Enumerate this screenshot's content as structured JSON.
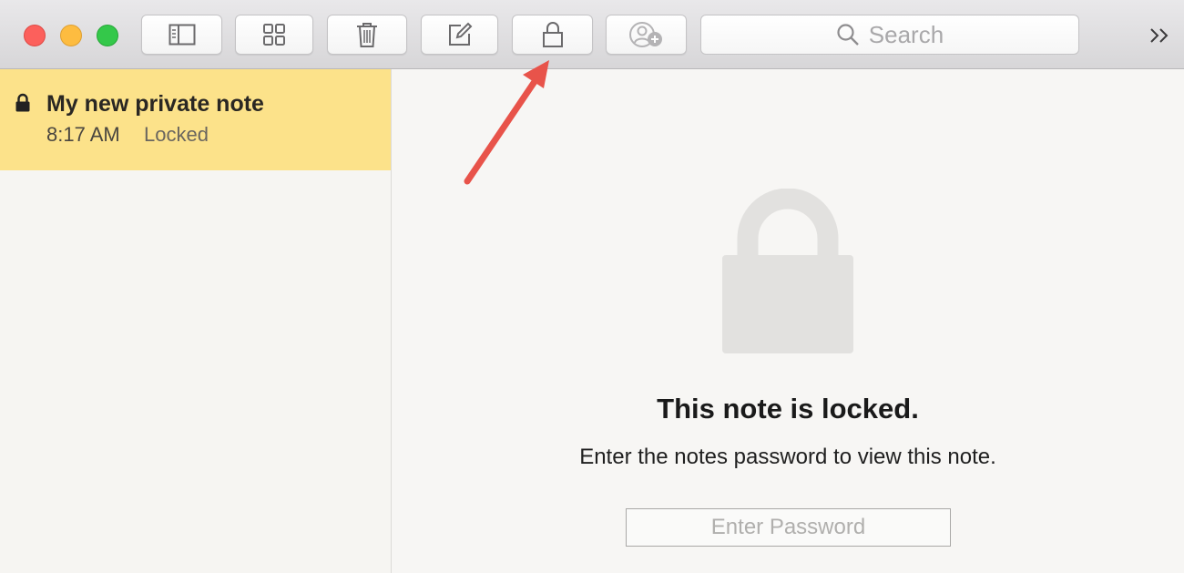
{
  "toolbar": {
    "buttons": [
      {
        "name": "toggle-sidebar",
        "icon": "sidebar-icon"
      },
      {
        "name": "attachments-browser",
        "icon": "grid-icon"
      },
      {
        "name": "delete-note",
        "icon": "trash-icon"
      },
      {
        "name": "new-note",
        "icon": "compose-icon"
      },
      {
        "name": "lock-note",
        "icon": "lock-icon"
      },
      {
        "name": "add-people",
        "icon": "add-person-icon"
      }
    ],
    "search_label": "Search",
    "more_icon": "double-chevron-right-icon"
  },
  "sidebar": {
    "notes": [
      {
        "title": "My new private note",
        "time": "8:17 AM",
        "status": "Locked",
        "selected": true
      }
    ]
  },
  "content": {
    "title": "This note is locked.",
    "subtitle": "Enter the notes password to view this note.",
    "password_placeholder": "Enter Password"
  },
  "colors": {
    "selected_note_bg": "#fce28a",
    "annotation_arrow": "#e8534a",
    "traffic_close": "#fc605c",
    "traffic_min": "#fdbc40",
    "traffic_zoom": "#34c84a"
  }
}
